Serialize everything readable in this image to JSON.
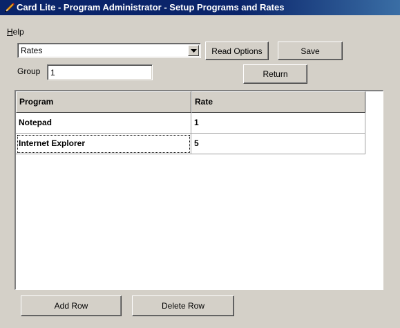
{
  "window": {
    "title": "Card Lite - Program Administrator - Setup Programs and Rates",
    "title_icon": "pencil-icon"
  },
  "menu": {
    "items": [
      {
        "label": "Help",
        "mnemonic": "H",
        "rest": "elp"
      }
    ]
  },
  "options": {
    "selected": "Rates"
  },
  "buttons": {
    "read_options": "Read Options",
    "save": "Save",
    "return": "Return",
    "add_row": "Add Row",
    "delete_row": "Delete Row"
  },
  "group": {
    "label": "Group",
    "value": "1"
  },
  "grid": {
    "columns": [
      "Program",
      "Rate"
    ],
    "rows": [
      {
        "program": "Notepad",
        "rate": "1"
      },
      {
        "program": "Internet Explorer",
        "rate": "5"
      }
    ]
  },
  "colors": {
    "title_bar": "#0a246a",
    "face": "#d4d0c8"
  }
}
